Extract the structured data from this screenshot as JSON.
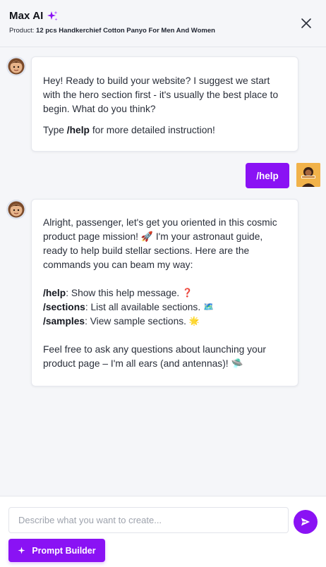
{
  "header": {
    "title": "Max AI",
    "product_label": "Product:",
    "product_name": "12 pcs Handkerchief Cotton Panyo For Men And Women"
  },
  "messages": {
    "bot1": {
      "line1": "Hey! Ready to build your website? I suggest we start with the hero section first - it's usually the best place to begin. What do you think?",
      "type_prefix": "Type",
      "type_command": "/help",
      "type_suffix": "for more detailed instruction!"
    },
    "user1": {
      "text": "/help"
    },
    "bot2": {
      "intro": "Alright, passenger, let's get you oriented in this cosmic product page mission! 🚀 I'm your astronaut guide, ready to help build stellar sections. Here are the commands you can beam my way:",
      "commands": [
        {
          "cmd": "/help",
          "desc": ": Show this help message.",
          "emoji": "❓"
        },
        {
          "cmd": "/sections",
          "desc": ": List all available sections.",
          "emoji": "🗺️"
        },
        {
          "cmd": "/samples",
          "desc": ": View sample sections.",
          "emoji": "🌟"
        }
      ],
      "outro": "Feel free to ask any questions about launching your product page – I'm all ears (and antennas)! 🛸"
    }
  },
  "composer": {
    "placeholder": "Describe what you want to create...",
    "prompt_builder_label": "Prompt Builder"
  },
  "icons": {
    "sparkle": "sparkle-icon",
    "close": "close-icon",
    "send": "send-icon"
  },
  "colors": {
    "accent": "#8a12f4",
    "background": "#f5f6f9"
  }
}
